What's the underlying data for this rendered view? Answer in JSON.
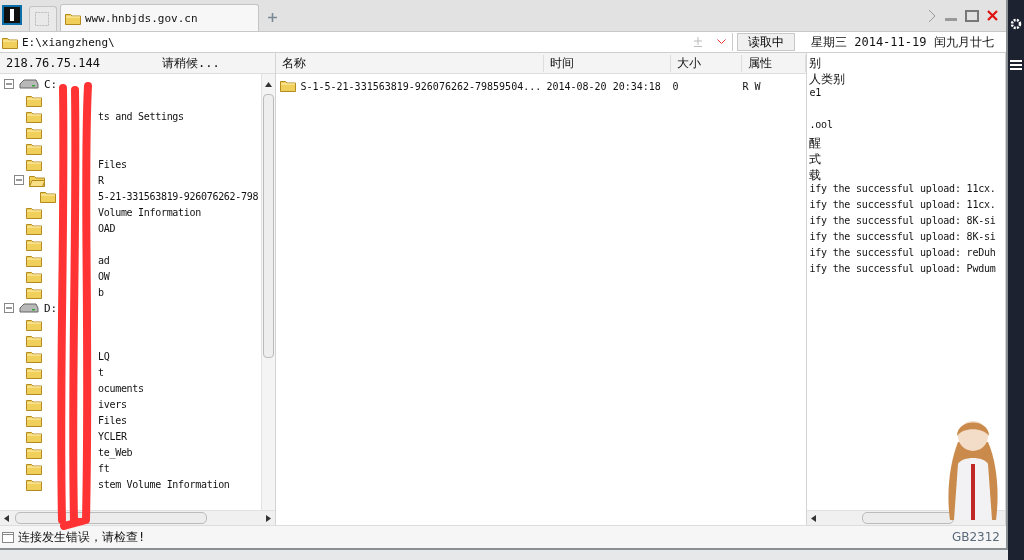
{
  "tabs": [
    {
      "kind": "blank",
      "selected": false
    },
    {
      "kind": "page",
      "label": "www.hnbjds.gov.cn",
      "selected": true
    }
  ],
  "address": {
    "value": "E:\\xiangzheng\\"
  },
  "read_button": "读取中",
  "date": "星期三 2014-11-19 闰九月廿七",
  "tree_header": {
    "host": "218.76.75.144",
    "status": "请稍候..."
  },
  "tree": [
    {
      "kind": "drive",
      "label": "C:",
      "expanded": true,
      "children": [
        {
          "kind": "folder"
        },
        {
          "kind": "folder",
          "label": "ts and Settings"
        },
        {
          "kind": "folder"
        },
        {
          "kind": "folder"
        },
        {
          "kind": "folder",
          "label": "Files"
        },
        {
          "kind": "folder",
          "label": "R",
          "expanded": true,
          "children": [
            {
              "kind": "folder",
              "label": "5-21-331563819-926076262-798"
            }
          ]
        },
        {
          "kind": "folder",
          "label": "Volume Information"
        },
        {
          "kind": "folder",
          "label": "OAD"
        },
        {
          "kind": "folder"
        },
        {
          "kind": "folder",
          "label": "ad"
        },
        {
          "kind": "folder",
          "label": "OW"
        },
        {
          "kind": "folder",
          "label": "b"
        }
      ]
    },
    {
      "kind": "drive",
      "label": "D:",
      "expanded": true,
      "children": [
        {
          "kind": "folder"
        },
        {
          "kind": "folder"
        },
        {
          "kind": "folder",
          "label": "LQ"
        },
        {
          "kind": "folder",
          "label": "t"
        },
        {
          "kind": "folder",
          "label": "ocuments"
        },
        {
          "kind": "folder",
          "label": "ivers"
        },
        {
          "kind": "folder",
          "label": "Files"
        },
        {
          "kind": "folder",
          "label": "YCLER"
        },
        {
          "kind": "folder",
          "label": "te_Web"
        },
        {
          "kind": "folder",
          "label": "ft"
        },
        {
          "kind": "folder",
          "label": "stem Volume Information"
        }
      ]
    }
  ],
  "file_table": {
    "columns": [
      "名称",
      "时间",
      "大小",
      "属性"
    ],
    "rows": [
      [
        "S-1-5-21-331563819-926076262-79859504...",
        "2014-08-20 20:34:18",
        "0",
        "R W"
      ]
    ]
  },
  "log_lines": [
    "别",
    "人类别",
    "e1",
    ".ool",
    "醒",
    "式",
    "载",
    "ify the successful upload: 11cx.",
    "ify the successful upload: 11cx.",
    "ify the successful upload: 8K-si",
    "ify the successful upload: 8K-si",
    "ify the successful upload: reDuh",
    "ify the successful upload: Pwdum"
  ],
  "status_bar": {
    "message": "连接发生错误，请检查!",
    "encoding": "GB2312"
  }
}
